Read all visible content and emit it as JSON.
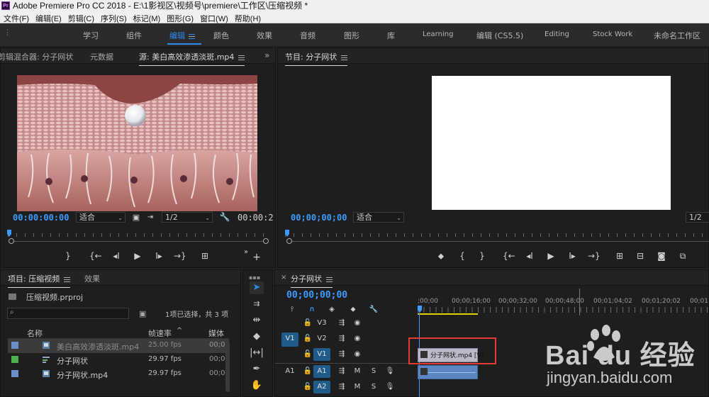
{
  "window": {
    "title": "Adobe Premiere Pro CC 2018 - E:\\1影视区\\视频号\\premiere\\工作区\\压缩视频 *",
    "logo": "Pr"
  },
  "menu": [
    "文件(F)",
    "编辑(E)",
    "剪辑(C)",
    "序列(S)",
    "标记(M)",
    "图形(G)",
    "窗口(W)",
    "帮助(H)"
  ],
  "workspaces": [
    {
      "label": "学习",
      "active": false
    },
    {
      "label": "组件",
      "active": false
    },
    {
      "label": "编辑",
      "active": true
    },
    {
      "label": "颜色",
      "active": false
    },
    {
      "label": "效果",
      "active": false
    },
    {
      "label": "音频",
      "active": false
    },
    {
      "label": "图形",
      "active": false
    },
    {
      "label": "库",
      "active": false
    },
    {
      "label": "Learning",
      "active": false
    },
    {
      "label": "编辑 (CS5.5)",
      "active": false
    },
    {
      "label": "Editing",
      "active": false
    },
    {
      "label": "Stock Work",
      "active": false
    },
    {
      "label": "未命名工作区",
      "active": false
    }
  ],
  "source_panel": {
    "tabs": [
      "音频剪辑混合器: 分子网状",
      "元数据",
      "源: 美白高效渗透淡斑.mp4"
    ],
    "timecode": "00:00:00:00",
    "fit": "适合",
    "resolution": "1/2",
    "duration": "00:00:2"
  },
  "program_panel": {
    "title": "节目: 分子网状",
    "timecode": "00;00;00;00",
    "fit": "适合",
    "resolution": "1/2"
  },
  "project_panel": {
    "tabs": [
      "项目: 压缩视频",
      "效果"
    ],
    "file": "压缩视频.prproj",
    "search_placeholder": "",
    "selection_status": "1项已选择，共 3 项",
    "columns": [
      "名称",
      "帧速率",
      "媒体开"
    ],
    "items": [
      {
        "name": "美白高效渗透淡斑.mp4",
        "fps": "25.00 fps",
        "tc": "00;0",
        "color": "#6b8fc7",
        "selected": true
      },
      {
        "name": "分子网状",
        "fps": "29.97 fps",
        "tc": "00;0",
        "color": "#4caf50",
        "selected": false
      },
      {
        "name": "分子网状.mp4",
        "fps": "29.97 fps",
        "tc": "00;0",
        "color": "#6b8fc7",
        "selected": false
      }
    ]
  },
  "timeline": {
    "tab": "分子网状",
    "timecode": "00;00;00;00",
    "ruler": [
      ";00;00",
      "00;00;16;00",
      "00;00;32;00",
      "00;00;48;00",
      "00;01;04;02",
      "00;01;20;02",
      "00;01"
    ],
    "tracks": [
      {
        "target": "",
        "name": "V3",
        "kind": "video"
      },
      {
        "target": "V1",
        "name": "V2",
        "kind": "video"
      },
      {
        "target": "",
        "name": "V1",
        "kind": "video"
      },
      {
        "target": "A1",
        "name": "A1",
        "kind": "audio",
        "m": "M",
        "s": "S"
      },
      {
        "target": "",
        "name": "A2",
        "kind": "audio",
        "m": "M",
        "s": "S"
      }
    ],
    "clip_label": "分子网状.mp4 [V]"
  },
  "watermark": {
    "brand": "Bai du 经验",
    "url": "jingyan.baidu.com"
  },
  "colors": {
    "accent": "#2d8ceb",
    "timecode": "#3b9cff",
    "clip_video": "#b9b9c9",
    "clip_audio": "#5b86c1",
    "annotation": "#e53935"
  }
}
